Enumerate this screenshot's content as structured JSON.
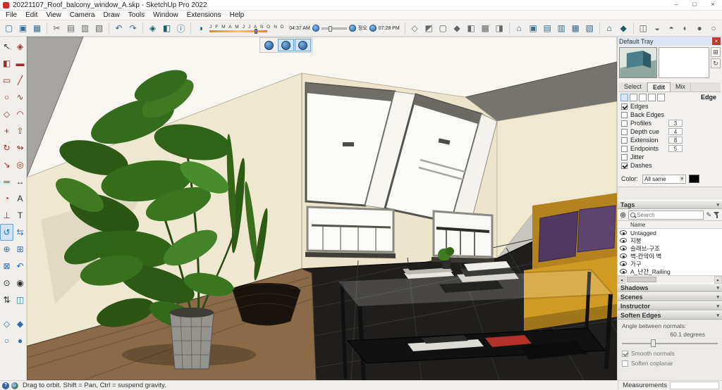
{
  "glyphs": {
    "minimize": "–",
    "maximize": "□",
    "close": "×",
    "caret_down": "▾",
    "caret_left": "◂",
    "caret_right": "▸",
    "caret_up": "▴",
    "plus": "⊕",
    "pencil": "✎",
    "refresh": "↻",
    "pane": "⊞",
    "question": "?"
  },
  "titlebar": {
    "title": "20221107_Roof_balcony_window_A.skp - SketchUp Pro 2022"
  },
  "menubar": {
    "items": [
      "File",
      "Edit",
      "View",
      "Camera",
      "Draw",
      "Tools",
      "Window",
      "Extensions",
      "Help"
    ]
  },
  "toolbar": {
    "glyphs": {
      "new": "▢",
      "open": "▣",
      "save": "▦",
      "cut": "✂",
      "copy": "▤",
      "paste": "▥",
      "erase": "▧",
      "undo": "↶",
      "redo": "↷",
      "component": "◈",
      "paint": "◧",
      "info": "ⓘ",
      "shadows": "◑",
      "s1": "◇",
      "s2": "◩",
      "s3": "▢",
      "s4": "◆",
      "s5": "◧",
      "s6": "▩",
      "s7": "◨",
      "v1": "⌂",
      "v2": "▣",
      "v3": "▤",
      "v4": "▥",
      "v5": "▦",
      "v6": "▧",
      "wh": "⌂",
      "ext": "◆",
      "m1": "◫",
      "m2": "◒",
      "m3": "◓",
      "m4": "◐",
      "m5": "●",
      "m6": "○"
    },
    "shadow": {
      "months": "J F M A M J J A S O N D",
      "sunrise": "04:37 AM",
      "noon": "정오",
      "sunset": "07:28 PM"
    }
  },
  "lefttools": {
    "glyphs": {
      "select": "↖",
      "component": "◈",
      "paint": "◧",
      "eraser": "▬",
      "rectangle": "▭",
      "line": "╱",
      "circle": "○",
      "freehand": "∿",
      "polygon": "◇",
      "arc": "◠",
      "move": "+",
      "pushpull": "⇧",
      "rotate": "↻",
      "followme": "↬",
      "scale": "↘",
      "offset": "◎",
      "tape": "═",
      "dimension": "↔",
      "protractor": "◔",
      "text": "A",
      "axes": "⊥",
      "text3d": "T",
      "orbit": "↺",
      "pan": "⇆",
      "zoom": "⊕",
      "zoomwin": "⊞",
      "zoomext": "⊠",
      "previous": "↶",
      "poscam": "⊙",
      "look": "◉",
      "walk": "⇅",
      "section": "◫",
      "x1": "◇",
      "x2": "◆",
      "x3": "○",
      "x4": "●"
    },
    "active_tool": "orbit"
  },
  "tray": {
    "title": "Default Tray",
    "styles": {
      "tabs": [
        "Select",
        "Edit",
        "Mix"
      ],
      "edge_label": "Edge",
      "rows": [
        {
          "label": "Edges",
          "checked": true
        },
        {
          "label": "Back Edges",
          "checked": false
        },
        {
          "label": "Profiles",
          "checked": false,
          "value": "3"
        },
        {
          "label": "Depth cue",
          "checked": false,
          "value": "4"
        },
        {
          "label": "Extension",
          "checked": false,
          "value": "8"
        },
        {
          "label": "Endpoints",
          "checked": false,
          "value": "5"
        },
        {
          "label": "Jitter",
          "checked": false
        },
        {
          "label": "Dashes",
          "checked": true
        }
      ],
      "color_label": "Color:",
      "color_value": "All same"
    },
    "tags": {
      "header": "Tags",
      "search_placeholder": "Search",
      "name_header": "Name",
      "rows": [
        "Untagged",
        "지붕",
        "슬래브-구조",
        "벽-칸막이 벽",
        "가구",
        "A_난간_Railing"
      ]
    },
    "sections": {
      "shadows": "Shadows",
      "scenes": "Scenes",
      "instructor": "Instructor",
      "soften": "Soften Edges"
    },
    "soften": {
      "angle_label": "Angle between normals:",
      "angle_value": "60.1  degrees",
      "smooth": "Smooth normals",
      "coplanar": "Soften coplanar"
    }
  },
  "statusbar": {
    "hint": "Drag to orbit. Shift = Pan, Ctrl = suspend gravity.",
    "measurements_label": "Measurements"
  }
}
